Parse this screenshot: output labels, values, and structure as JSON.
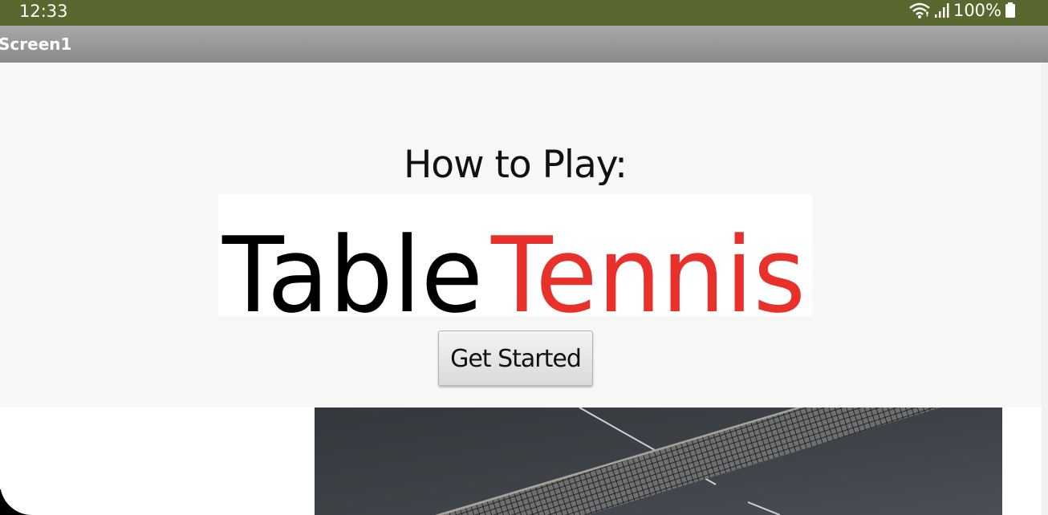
{
  "status_bar": {
    "time": "12:33",
    "battery": "100%",
    "icons": [
      "wifi-icon",
      "signal-icon",
      "battery-icon"
    ],
    "background": "#58682f"
  },
  "app_bar": {
    "title": "Screen1"
  },
  "main": {
    "heading": "How to Play:",
    "logo": {
      "word1": "Table",
      "word2": "Tennis",
      "word1_color": "#000000",
      "word2_color": "#e8312a"
    },
    "button_label": "Get Started",
    "image": "table-tennis-net-photo"
  }
}
